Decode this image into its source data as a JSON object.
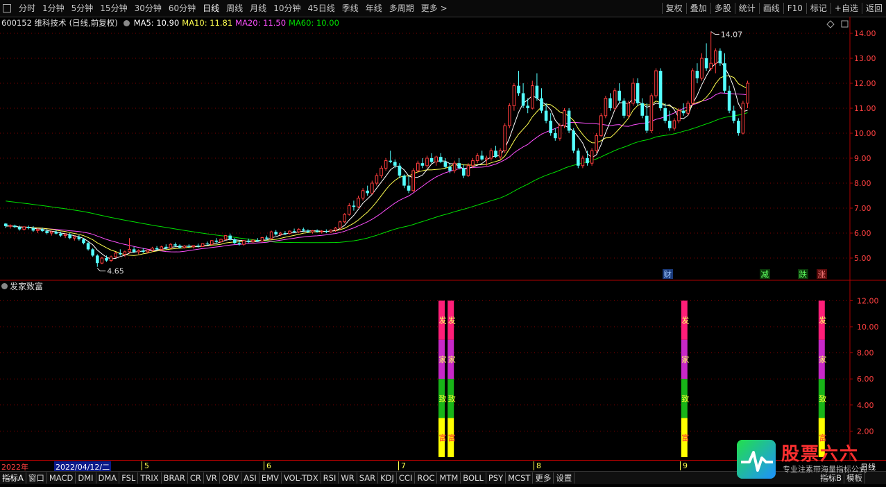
{
  "toolbar": {
    "periods": [
      "分时",
      "1分钟",
      "5分钟",
      "15分钟",
      "30分钟",
      "60分钟",
      "日线",
      "周线",
      "月线",
      "10分钟",
      "45日线",
      "季线",
      "年线",
      "多周期",
      "更多 >"
    ],
    "active_period": "日线",
    "right_buttons": [
      "复权",
      "叠加",
      "多股",
      "统计",
      "画线",
      "F10",
      "标记",
      "+自选",
      "返回"
    ]
  },
  "stock_info": {
    "code_name": "600152 维科技术",
    "mode": "(日线,前复权)",
    "ma5": "MA5: 10.90",
    "ma10": "MA10: 11.81",
    "ma20": "MA20: 11.50",
    "ma60": "MA60: 10.00"
  },
  "colors": {
    "up": "#ff3c3c",
    "down": "#54ffff",
    "ma5": "#ffffff",
    "ma10": "#ffff50",
    "ma20": "#ff50ff",
    "ma60": "#00e000",
    "axis": "#b00000",
    "grid": "#800000"
  },
  "price_axis": {
    "labels": [
      "14.00",
      "13.00",
      "12.00",
      "11.00",
      "10.00",
      "9.00",
      "8.00",
      "7.00",
      "6.00",
      "5.00"
    ]
  },
  "annotations": {
    "high": "14.07",
    "low": "4.65"
  },
  "event_markers": [
    {
      "text": "财",
      "bg": "#1a3a7a",
      "color": "#9ec6ff"
    },
    {
      "text": "减",
      "bg": "#0a3a0a",
      "color": "#60ff60"
    },
    {
      "text": "跌",
      "bg": "#0a3a0a",
      "color": "#60ff60"
    },
    {
      "text": "涨",
      "bg": "#5a0a0a",
      "color": "#ff8080"
    }
  ],
  "indicator_pane": {
    "title": "发家致富",
    "axis_labels": [
      "12.00",
      "10.00",
      "8.00",
      "6.00",
      "4.00",
      "2.00"
    ],
    "bar_chars": [
      "发",
      "家",
      "致",
      "富"
    ],
    "segment_colors": [
      "#ff1e78",
      "#c828c8",
      "#18b418",
      "#ffff00"
    ]
  },
  "chart_data": {
    "type": "candlestick",
    "ylim": [
      4.5,
      14.3
    ],
    "candles": [
      [
        6.38,
        6.4,
        6.2,
        6.28
      ],
      [
        6.28,
        6.35,
        6.18,
        6.3
      ],
      [
        6.3,
        6.34,
        6.2,
        6.24
      ],
      [
        6.24,
        6.3,
        6.1,
        6.15
      ],
      [
        6.15,
        6.28,
        6.1,
        6.25
      ],
      [
        6.25,
        6.3,
        6.15,
        6.2
      ],
      [
        6.2,
        6.28,
        6.05,
        6.1
      ],
      [
        6.1,
        6.2,
        6.0,
        6.15
      ],
      [
        6.15,
        6.22,
        6.05,
        6.08
      ],
      [
        6.08,
        6.15,
        5.95,
        6.0
      ],
      [
        6.0,
        6.1,
        5.9,
        6.05
      ],
      [
        6.05,
        6.12,
        5.95,
        5.98
      ],
      [
        5.98,
        6.05,
        5.85,
        5.9
      ],
      [
        5.9,
        6.0,
        5.8,
        5.95
      ],
      [
        5.95,
        6.0,
        5.75,
        5.8
      ],
      [
        5.8,
        5.9,
        5.7,
        5.85
      ],
      [
        5.85,
        5.92,
        5.7,
        5.75
      ],
      [
        5.75,
        5.8,
        5.55,
        5.6
      ],
      [
        5.6,
        5.65,
        5.3,
        5.35
      ],
      [
        5.35,
        5.4,
        5.05,
        5.1
      ],
      [
        5.1,
        5.15,
        4.65,
        4.8
      ],
      [
        4.8,
        5.05,
        4.75,
        5.0
      ],
      [
        5.0,
        5.1,
        4.85,
        4.9
      ],
      [
        4.9,
        5.1,
        4.85,
        5.05
      ],
      [
        5.05,
        5.25,
        5.0,
        5.2
      ],
      [
        5.2,
        5.35,
        5.1,
        5.15
      ],
      [
        5.15,
        5.3,
        5.05,
        5.25
      ],
      [
        5.25,
        5.8,
        5.2,
        5.35
      ],
      [
        5.35,
        5.45,
        5.2,
        5.25
      ],
      [
        5.25,
        5.35,
        5.15,
        5.3
      ],
      [
        5.3,
        5.4,
        5.2,
        5.25
      ],
      [
        5.25,
        5.35,
        5.18,
        5.32
      ],
      [
        5.32,
        5.45,
        5.25,
        5.4
      ],
      [
        5.4,
        5.48,
        5.3,
        5.35
      ],
      [
        5.35,
        5.5,
        5.3,
        5.45
      ],
      [
        5.45,
        5.55,
        5.35,
        5.4
      ],
      [
        5.4,
        5.6,
        5.38,
        5.55
      ],
      [
        5.55,
        5.62,
        5.45,
        5.5
      ],
      [
        5.5,
        5.55,
        5.38,
        5.42
      ],
      [
        5.42,
        5.52,
        5.38,
        5.48
      ],
      [
        5.48,
        5.55,
        5.4,
        5.45
      ],
      [
        5.45,
        5.52,
        5.38,
        5.5
      ],
      [
        5.5,
        5.58,
        5.42,
        5.46
      ],
      [
        5.46,
        5.6,
        5.44,
        5.58
      ],
      [
        5.58,
        5.66,
        5.5,
        5.55
      ],
      [
        5.55,
        5.72,
        5.52,
        5.7
      ],
      [
        5.7,
        5.8,
        5.6,
        5.65
      ],
      [
        5.65,
        5.78,
        5.6,
        5.75
      ],
      [
        5.75,
        5.92,
        5.7,
        5.9
      ],
      [
        5.9,
        5.98,
        5.7,
        5.75
      ],
      [
        5.75,
        5.8,
        5.55,
        5.6
      ],
      [
        5.6,
        5.7,
        5.5,
        5.55
      ],
      [
        5.55,
        5.72,
        5.5,
        5.7
      ],
      [
        5.7,
        5.78,
        5.6,
        5.65
      ],
      [
        5.65,
        5.75,
        5.58,
        5.72
      ],
      [
        5.72,
        5.8,
        5.65,
        5.68
      ],
      [
        5.68,
        5.85,
        5.65,
        5.82
      ],
      [
        5.82,
        5.9,
        5.72,
        5.78
      ],
      [
        5.78,
        6.1,
        5.75,
        6.05
      ],
      [
        6.05,
        6.12,
        5.9,
        5.95
      ],
      [
        5.95,
        6.05,
        5.88,
        6.0
      ],
      [
        6.0,
        6.08,
        5.92,
        5.98
      ],
      [
        5.98,
        6.1,
        5.95,
        6.08
      ],
      [
        6.08,
        6.18,
        6.0,
        6.05
      ],
      [
        6.05,
        6.2,
        6.0,
        6.15
      ],
      [
        6.15,
        6.22,
        6.05,
        6.1
      ],
      [
        6.1,
        6.15,
        6.0,
        6.05
      ],
      [
        6.05,
        6.12,
        5.98,
        6.1
      ],
      [
        6.1,
        6.15,
        6.02,
        6.05
      ],
      [
        6.05,
        6.12,
        5.98,
        6.08
      ],
      [
        6.08,
        6.15,
        6.0,
        6.05
      ],
      [
        6.05,
        6.15,
        6.0,
        6.12
      ],
      [
        6.12,
        6.25,
        6.05,
        6.2
      ],
      [
        6.2,
        6.5,
        6.15,
        6.45
      ],
      [
        6.45,
        6.8,
        6.4,
        6.75
      ],
      [
        6.75,
        7.2,
        6.7,
        7.1
      ],
      [
        7.1,
        7.3,
        6.9,
        7.05
      ],
      [
        7.05,
        7.5,
        7.0,
        7.4
      ],
      [
        7.4,
        7.8,
        7.3,
        7.7
      ],
      [
        7.7,
        7.9,
        7.5,
        7.6
      ],
      [
        7.6,
        8.1,
        7.55,
        8.0
      ],
      [
        8.0,
        8.4,
        7.9,
        8.3
      ],
      [
        8.3,
        8.7,
        8.2,
        8.6
      ],
      [
        8.6,
        9.0,
        8.5,
        8.9
      ],
      [
        8.9,
        9.3,
        8.8,
        8.85
      ],
      [
        8.85,
        8.95,
        8.6,
        8.7
      ],
      [
        8.7,
        8.8,
        8.2,
        8.3
      ],
      [
        8.3,
        8.35,
        7.8,
        7.9
      ],
      [
        7.9,
        8.3,
        7.6,
        7.7
      ],
      [
        7.7,
        8.6,
        7.65,
        8.5
      ],
      [
        8.5,
        8.9,
        8.4,
        8.8
      ],
      [
        8.8,
        9.0,
        8.6,
        8.7
      ],
      [
        8.7,
        9.1,
        8.6,
        9.0
      ],
      [
        9.0,
        9.2,
        8.8,
        8.85
      ],
      [
        8.85,
        9.1,
        8.7,
        9.05
      ],
      [
        9.05,
        9.2,
        8.8,
        8.85
      ],
      [
        8.85,
        9.0,
        8.6,
        8.65
      ],
      [
        8.65,
        8.8,
        8.4,
        8.5
      ],
      [
        8.5,
        8.9,
        8.4,
        8.8
      ],
      [
        8.8,
        9.0,
        8.55,
        8.6
      ],
      [
        8.6,
        8.75,
        8.2,
        8.3
      ],
      [
        8.3,
        8.8,
        8.25,
        8.7
      ],
      [
        8.7,
        9.0,
        8.6,
        8.9
      ],
      [
        8.9,
        9.2,
        8.8,
        9.1
      ],
      [
        9.1,
        9.3,
        8.9,
        8.95
      ],
      [
        8.95,
        9.1,
        8.7,
        9.0
      ],
      [
        9.0,
        9.4,
        8.9,
        9.3
      ],
      [
        9.3,
        9.5,
        9.0,
        9.05
      ],
      [
        9.05,
        9.4,
        8.95,
        9.3
      ],
      [
        9.3,
        10.4,
        9.2,
        10.3
      ],
      [
        10.3,
        11.2,
        10.2,
        11.1
      ],
      [
        11.1,
        12.0,
        10.9,
        11.9
      ],
      [
        11.9,
        12.5,
        11.5,
        11.6
      ],
      [
        11.6,
        12.0,
        11.0,
        11.1
      ],
      [
        11.1,
        11.4,
        10.8,
        11.0
      ],
      [
        11.0,
        12.1,
        10.95,
        11.9
      ],
      [
        11.9,
        12.4,
        11.3,
        11.4
      ],
      [
        11.4,
        11.8,
        10.8,
        10.9
      ],
      [
        10.9,
        11.2,
        10.4,
        10.5
      ],
      [
        10.5,
        10.8,
        9.9,
        10.0
      ],
      [
        10.0,
        10.2,
        9.7,
        9.8
      ],
      [
        9.8,
        10.4,
        9.7,
        10.3
      ],
      [
        10.3,
        11.0,
        10.2,
        10.9
      ],
      [
        10.9,
        11.0,
        10.0,
        10.1
      ],
      [
        10.1,
        10.2,
        9.2,
        9.3
      ],
      [
        9.3,
        9.4,
        8.6,
        8.7
      ],
      [
        8.7,
        9.1,
        8.6,
        9.0
      ],
      [
        9.0,
        9.3,
        8.7,
        8.8
      ],
      [
        8.8,
        9.4,
        8.7,
        9.3
      ],
      [
        9.3,
        10.0,
        9.2,
        9.9
      ],
      [
        9.9,
        10.8,
        9.85,
        10.7
      ],
      [
        10.7,
        11.5,
        10.6,
        11.4
      ],
      [
        11.4,
        11.6,
        10.9,
        11.0
      ],
      [
        11.0,
        11.8,
        10.9,
        11.7
      ],
      [
        11.7,
        12.0,
        11.2,
        11.3
      ],
      [
        11.3,
        11.4,
        10.6,
        10.7
      ],
      [
        10.7,
        11.3,
        10.6,
        11.2
      ],
      [
        11.2,
        12.2,
        11.1,
        12.0
      ],
      [
        12.0,
        12.2,
        11.1,
        11.2
      ],
      [
        11.2,
        11.4,
        10.6,
        10.7
      ],
      [
        10.7,
        11.2,
        10.0,
        10.1
      ],
      [
        10.1,
        11.6,
        10.0,
        11.5
      ],
      [
        11.5,
        12.6,
        11.4,
        12.5
      ],
      [
        12.5,
        12.6,
        10.9,
        11.0
      ],
      [
        11.0,
        11.2,
        10.4,
        10.5
      ],
      [
        10.5,
        10.9,
        10.1,
        10.2
      ],
      [
        10.2,
        10.6,
        10.1,
        10.5
      ],
      [
        10.5,
        11.0,
        10.4,
        10.9
      ],
      [
        10.9,
        11.2,
        10.7,
        10.8
      ],
      [
        10.8,
        11.3,
        10.7,
        11.2
      ],
      [
        11.2,
        12.6,
        11.1,
        12.5
      ],
      [
        12.5,
        12.8,
        12.0,
        12.2
      ],
      [
        12.2,
        13.2,
        12.1,
        13.0
      ],
      [
        13.0,
        13.6,
        12.5,
        12.6
      ],
      [
        12.6,
        14.07,
        12.5,
        12.8
      ],
      [
        12.8,
        13.4,
        12.4,
        13.3
      ],
      [
        13.3,
        13.4,
        12.7,
        12.8
      ],
      [
        12.8,
        13.2,
        11.6,
        11.7
      ],
      [
        11.7,
        11.9,
        10.8,
        10.9
      ],
      [
        10.9,
        11.1,
        10.4,
        10.5
      ],
      [
        10.5,
        10.6,
        9.9,
        10.0
      ],
      [
        10.0,
        11.3,
        9.95,
        11.2
      ],
      [
        11.2,
        12.1,
        11.0,
        12.0
      ]
    ],
    "signal_bars": [
      95,
      97,
      148,
      178
    ],
    "indicator_ylim": [
      0,
      12.5
    ]
  },
  "date_bar": [
    {
      "text": "2022年",
      "color": "#ff4040",
      "highlight": false
    },
    {
      "text": "2022/04/12/二",
      "color": "#ffffff",
      "highlight": true
    },
    {
      "text": "5",
      "color": "#ffff50",
      "highlight": false
    },
    {
      "text": "6",
      "color": "#ffff50",
      "highlight": false
    },
    {
      "text": "7",
      "color": "#ffff50",
      "highlight": false
    },
    {
      "text": "8",
      "color": "#ffff50",
      "highlight": false
    },
    {
      "text": "9",
      "color": "#ffff50",
      "highlight": false
    },
    {
      "text": "日线",
      "color": "#ffffff",
      "highlight": false
    }
  ],
  "bottom_tabs": [
    "指标A",
    "窗口",
    "MACD",
    "DMI",
    "DMA",
    "FSL",
    "TRIX",
    "BRAR",
    "CR",
    "VR",
    "OBV",
    "ASI",
    "EMV",
    "VOL-TDX",
    "RSI",
    "WR",
    "SAR",
    "KDJ",
    "CCI",
    "ROC",
    "MTM",
    "BOLL",
    "PSY",
    "MCST",
    "更多",
    "设置"
  ],
  "bottom_right": {
    "indicator_btn": "指标B",
    "mode_btn": "模板"
  },
  "watermark": {
    "title": "股票六六",
    "subtitle": "专业注素带海量指标公式"
  }
}
